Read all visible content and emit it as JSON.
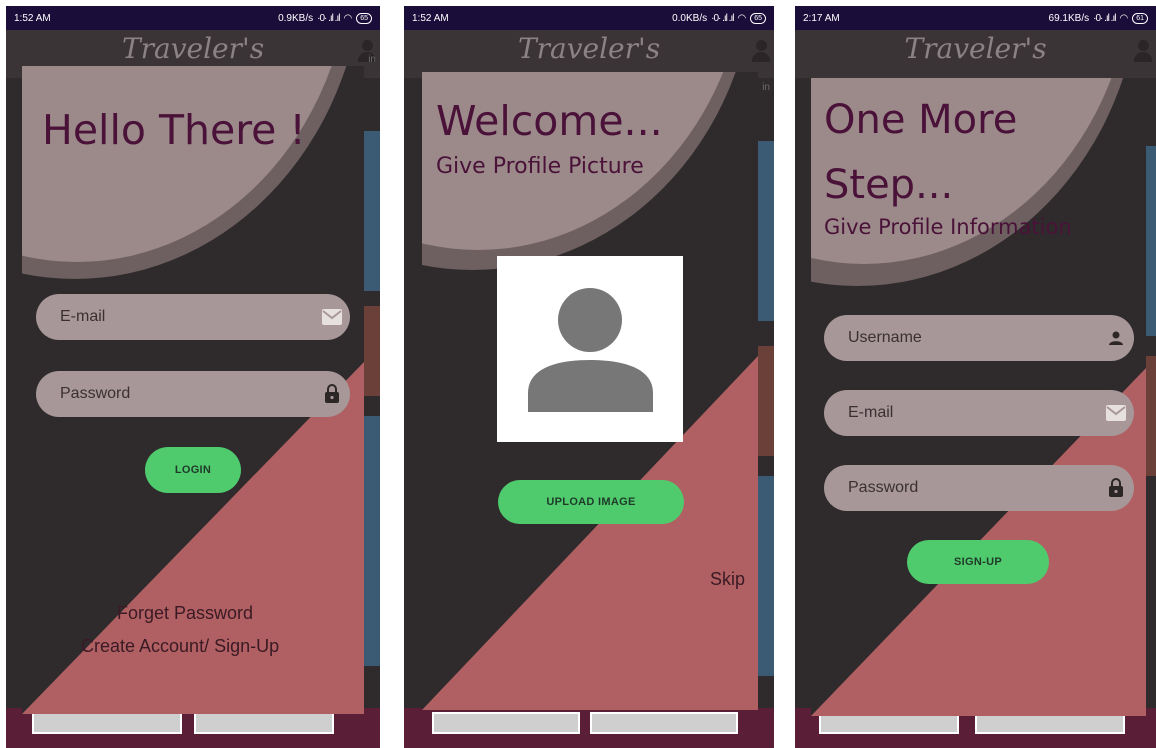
{
  "screens": [
    {
      "status": {
        "time": "1:52 AM",
        "speed": "0.9KB/s",
        "battery": "65"
      },
      "app_title": "Traveler's",
      "side_label": "in",
      "title": "Hello There !",
      "fields": [
        {
          "placeholder": "E-mail",
          "icon": "mail-icon"
        },
        {
          "placeholder": "Password",
          "icon": "lock-icon"
        }
      ],
      "button_label": "LOGIN",
      "links": [
        "Forget Password",
        "Create Account/ Sign-Up"
      ]
    },
    {
      "status": {
        "time": "1:52 AM",
        "speed": "0.0KB/s",
        "battery": "65"
      },
      "app_title": "Traveler's",
      "side_label": "in",
      "title": "Welcome...",
      "subtitle": "Give Profile Picture",
      "avatar_icon": "person-placeholder-icon",
      "button_label": "UPLOAD IMAGE",
      "skip_label": "Skip"
    },
    {
      "status": {
        "time": "2:17 AM",
        "speed": "69.1KB/s",
        "battery": "61"
      },
      "app_title": "Traveler's",
      "title_line1": "One More",
      "title_line2": "Step...",
      "subtitle": "Give Profile Information",
      "fields": [
        {
          "placeholder": "Username",
          "icon": "person-icon"
        },
        {
          "placeholder": "E-mail",
          "icon": "mail-icon"
        },
        {
          "placeholder": "Password",
          "icon": "lock-icon"
        }
      ],
      "button_label": "SIGN-UP"
    }
  ],
  "colors": {
    "status_bar": "#1a0d3a",
    "card_dark": "#2f2b2c",
    "card_top": "#9c8a8b",
    "card_top_shadow": "#6e5f60",
    "accent_red": "#b06063",
    "title_color": "#4a1238",
    "field_bg": "#a79798",
    "button_green": "#4fcb6e"
  }
}
